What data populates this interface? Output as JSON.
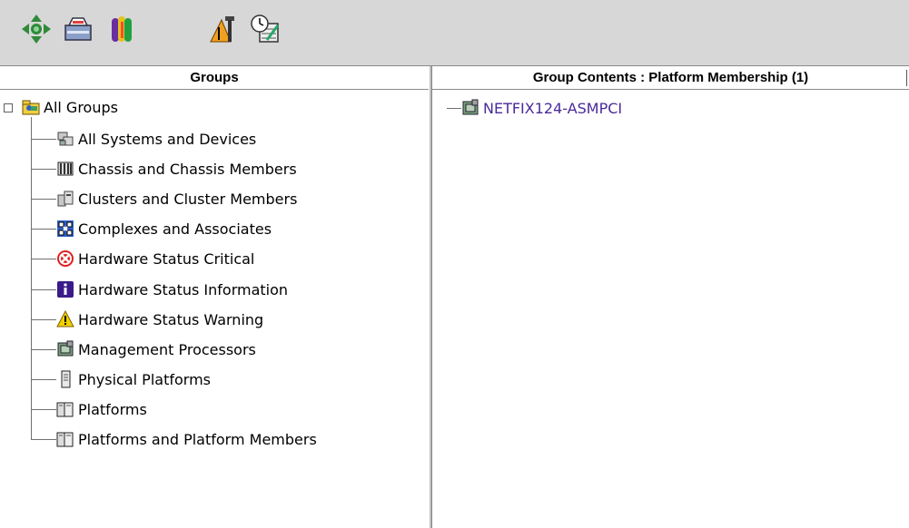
{
  "toolbar": {
    "buttons": [
      {
        "id": "move",
        "icon": "move-arrows-icon"
      },
      {
        "id": "mail",
        "icon": "tray-icon"
      },
      {
        "id": "users",
        "icon": "people-icon"
      },
      {
        "id": "tools",
        "icon": "tools-icon"
      },
      {
        "id": "schedule",
        "icon": "clock-edit-icon"
      }
    ]
  },
  "groups_panel": {
    "header": "Groups",
    "root": {
      "label": "All Groups",
      "icon": "group-folder-icon"
    },
    "items": [
      {
        "label": "All Systems and Devices",
        "icon": "systems-devices-icon"
      },
      {
        "label": "Chassis and Chassis Members",
        "icon": "chassis-icon"
      },
      {
        "label": "Clusters and Cluster Members",
        "icon": "cluster-icon"
      },
      {
        "label": "Complexes and Associates",
        "icon": "complex-icon"
      },
      {
        "label": "Hardware Status Critical",
        "icon": "critical-icon",
        "color": "#e02020"
      },
      {
        "label": "Hardware Status Information",
        "icon": "info-icon",
        "color": "#3a1a8a"
      },
      {
        "label": "Hardware Status Warning",
        "icon": "warning-icon",
        "color": "#f0d000"
      },
      {
        "label": "Management Processors",
        "icon": "management-processor-icon"
      },
      {
        "label": "Physical Platforms",
        "icon": "physical-platform-icon"
      },
      {
        "label": "Platforms",
        "icon": "platform-icon"
      },
      {
        "label": "Platforms and Platform Members",
        "icon": "platform-members-icon"
      }
    ]
  },
  "contents_panel": {
    "header": "Group Contents : Platform Membership (1)",
    "items": [
      {
        "label": "NETFIX124-ASMPCI",
        "icon": "management-processor-icon",
        "color": "#4a2a9a"
      }
    ]
  }
}
